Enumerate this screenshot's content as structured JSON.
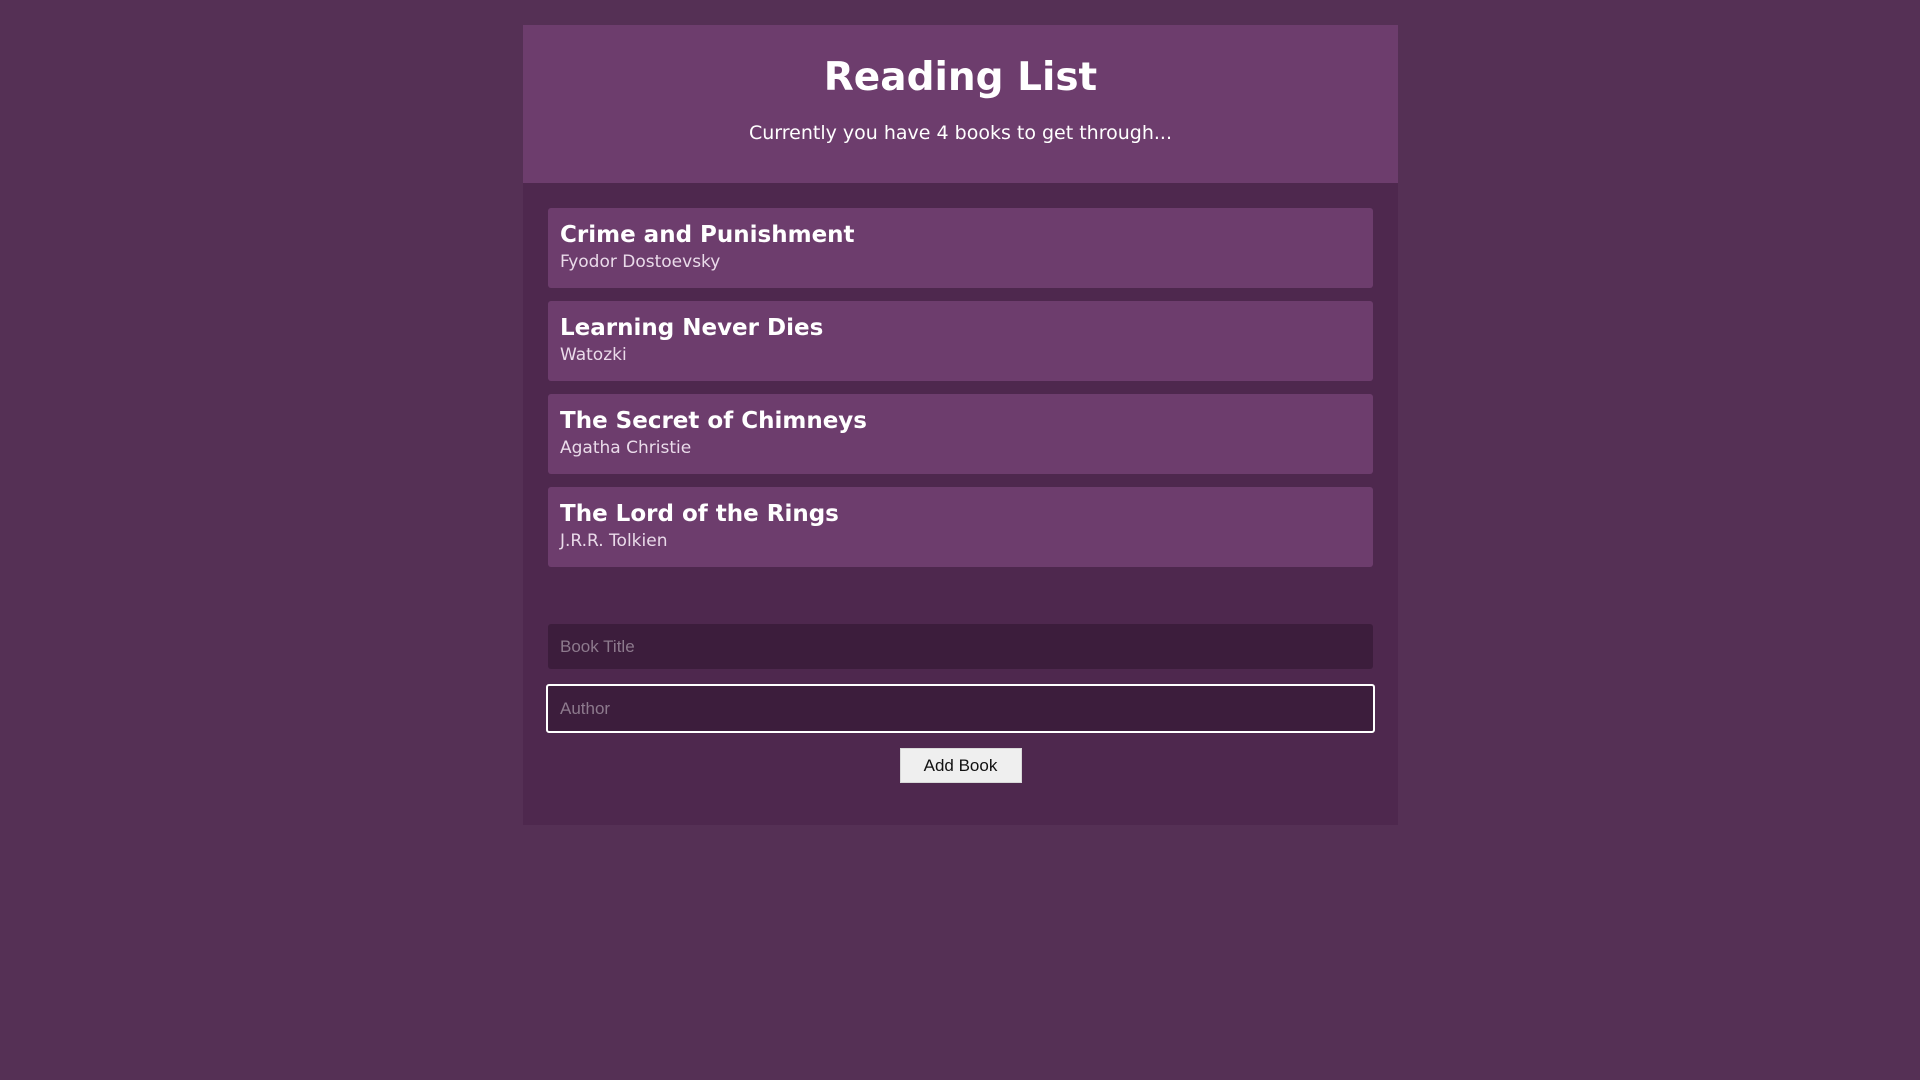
{
  "header": {
    "title": "Reading List",
    "subtitle": "Currently you have 4 books to get through..."
  },
  "books": [
    {
      "title": "Crime and Punishment",
      "author": "Fyodor Dostoevsky"
    },
    {
      "title": "Learning Never Dies",
      "author": "Watozki"
    },
    {
      "title": "The Secret of Chimneys",
      "author": "Agatha Christie"
    },
    {
      "title": "The Lord of the Rings",
      "author": "J.R.R. Tolkien"
    }
  ],
  "form": {
    "title_placeholder": "Book Title",
    "title_value": "",
    "author_placeholder": "Author",
    "author_value": "",
    "submit_label": "Add Book"
  },
  "colors": {
    "page_background": "#553055",
    "panel_background": "#4e284e",
    "card_background": "#6d3d6d",
    "input_background": "#3c1d3c"
  }
}
